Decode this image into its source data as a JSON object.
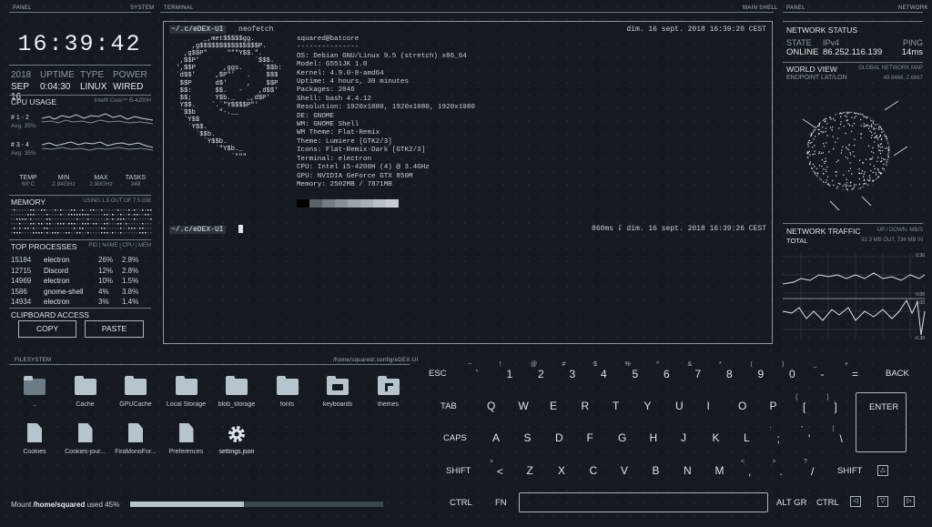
{
  "labels": {
    "panel_left": "PANEL",
    "system": "SYSTEM",
    "terminal": "TERMINAL",
    "main_shell": "MAIN SHELL",
    "panel_right": "PANEL",
    "network": "NETWORK",
    "filesystem": "FILESYSTEM",
    "fs_path": "/home/squared/.config/eDEX-UI"
  },
  "clock": "16:39:42",
  "sysinfo": {
    "headers": [
      "2018",
      "UPTIME",
      "TYPE",
      "POWER"
    ],
    "values": [
      "SEP 16",
      "0:04:30",
      "LINUX",
      "WIRED"
    ]
  },
  "cpu": {
    "title": "CPU USAGE",
    "model": "Intel® Core™ i5-4200H",
    "rows": [
      {
        "label": "# 1 - 2",
        "avg": "Avg. 35%"
      },
      {
        "label": "# 3 - 4",
        "avg": "Avg. 35%"
      }
    ],
    "stats_headers": [
      "TEMP",
      "MIN",
      "MAX",
      "TASKS"
    ],
    "stats_values": [
      "68°C",
      "2.94GHz",
      "2.99GHz",
      "248"
    ]
  },
  "memory": {
    "title": "MEMORY",
    "usage": "USING 1.5 OUT OF 7.5 GiB"
  },
  "processes": {
    "title": "TOP PROCESSES",
    "columns": "PID | NAME | CPU | MEM",
    "rows": [
      {
        "pid": "15184",
        "name": "electron",
        "cpu": "26%",
        "mem": "2.8%"
      },
      {
        "pid": "12715",
        "name": "Discord",
        "cpu": "12%",
        "mem": "2.8%"
      },
      {
        "pid": "14969",
        "name": "electron",
        "cpu": "10%",
        "mem": "1.5%"
      },
      {
        "pid": "1586",
        "name": "gnome-shell",
        "cpu": "4%",
        "mem": "3.8%"
      },
      {
        "pid": "14934",
        "name": "electron",
        "cpu": "3%",
        "mem": "1.4%"
      }
    ]
  },
  "clipboard": {
    "title": "CLIPBOARD ACCESS",
    "copy": "COPY",
    "paste": "PASTE"
  },
  "terminal": {
    "prompt": "~/.c/eDEX-UI",
    "command": "neofetch",
    "timestamp1": "dim. 16 sept. 2018 16:39:20 CEST",
    "timestamp2": "860ms ⮦ dim. 16 sept. 2018 16:39:26 CEST",
    "ascii": "        _,met$$$$$gg.\n     ,g$$$$$$$$$$$$$$$P.\n   ,g$$P\"     \"\"\"Y$$.\".\n  ,$$P'              `$$$.\n ',$$P       ,ggs.     `$$b:\n `d$$'     ,$P\"'   .    $$$\n  $$P      d$'     ,    $$P\n  $$:      $$.   -    ,d$$'\n  $$;      Y$b._   _,d$P'\n  Y$$.    `.`\"Y$$$$P\"'\n  `$$b      \"-.__\n   `Y$$\n    `Y$$.\n      `$$b.\n        `Y$$b.\n           `\"Y$b._\n               `\"\"\"",
    "info": "squared@batcore\n---------------\nOS: Debian GNU/Linux 9.5 (stretch) x86_64\nModel: G551JK 1.0\nKernel: 4.9.0-8-amd64\nUptime: 4 hours, 30 minutes\nPackages: 2046\nShell: bash 4.4.12\nResolution: 1920x1080, 1920x1080, 1920x1080\nDE: GNOME\nWM: GNOME Shell\nWM Theme: Flat-Remix\nTheme: Lumiere [GTK2/3]\nIcons: Flat-Remix-Dark [GTK2/3]\nTerminal: electron\nCPU: Intel i5-4200H (4) @ 3.4GHz\nGPU: NVIDIA GeForce GTX 850M\nMemory: 2502MB / 7871MB",
    "swatch_colors": [
      "#000000",
      "#5a6166",
      "#737a80",
      "#888f95",
      "#9ba2a8",
      "#aab1b6",
      "#b9c0c5",
      "#c7cdd1"
    ]
  },
  "network": {
    "status_title": "NETWORK STATUS",
    "headers": [
      "STATE",
      "IPv4",
      "PING"
    ],
    "values": [
      "ONLINE",
      "86.252.116.139",
      "14ms"
    ],
    "world_title": "WORLD VIEW",
    "world_sub": "GLOBAL NETWORK MAP",
    "endpoint": "ENDPOINT LAT/LON",
    "endpoint_val": "48.8466, 2.6667",
    "traffic_title": "NETWORK TRAFFIC",
    "traffic_sub": "UP / DOWN, MB/S",
    "total": "TOTAL",
    "total_val": "92.3 MB OUT, 736 MB IN",
    "axis": [
      "0.30",
      "0.00",
      "0.00",
      "-0.30"
    ]
  },
  "filesystem": {
    "items": [
      {
        "name": "..",
        "icon": "folder-up-icon"
      },
      {
        "name": "Cache",
        "icon": "folder-icon"
      },
      {
        "name": "GPUCache",
        "icon": "folder-icon"
      },
      {
        "name": "Local Storage",
        "icon": "folder-icon"
      },
      {
        "name": "blob_storage",
        "icon": "folder-icon"
      },
      {
        "name": "fonts",
        "icon": "folder-icon"
      },
      {
        "name": "keyboards",
        "icon": "keyboard-icon"
      },
      {
        "name": "themes",
        "icon": "themes-icon"
      },
      {
        "name": "Cookies",
        "icon": "file-icon"
      },
      {
        "name": "Cookies-jour...",
        "icon": "file-icon"
      },
      {
        "name": "FiraMonoFor...",
        "icon": "file-icon"
      },
      {
        "name": "Preferences",
        "icon": "file-icon"
      },
      {
        "name": "settings.json",
        "icon": "gear-icon"
      }
    ],
    "mount_prefix": "Mount",
    "mount_path": "/home/squared",
    "mount_used": "used 45%",
    "mount_fraction": 0.45
  },
  "keyboard": {
    "esc": "ESC",
    "back": "BACK",
    "tab": "TAB",
    "enter": "ENTER",
    "caps": "CAPS",
    "shift": "SHIFT",
    "ctrl": "CTRL",
    "fn": "FN",
    "altgr": "ALT GR",
    "row1": [
      [
        "~",
        "`"
      ],
      [
        "!",
        "1"
      ],
      [
        "@",
        "2"
      ],
      [
        "#",
        "3"
      ],
      [
        "$",
        "4"
      ],
      [
        "%",
        "5"
      ],
      [
        "^",
        "6"
      ],
      [
        "&",
        "7"
      ],
      [
        "*",
        "8"
      ],
      [
        "(",
        "9"
      ],
      [
        ")",
        "0"
      ],
      [
        "_",
        "-"
      ],
      [
        "+",
        "="
      ]
    ],
    "row2": [
      "Q",
      "W",
      "E",
      "R",
      "T",
      "Y",
      "U",
      "I",
      "O",
      "P",
      [
        "{",
        "["
      ],
      [
        "}",
        "]"
      ]
    ],
    "row3": [
      "A",
      "S",
      "D",
      "F",
      "G",
      "H",
      "J",
      "K",
      "L",
      [
        ":",
        ";"
      ],
      [
        "\"",
        "'"
      ],
      [
        "|",
        "\\"
      ]
    ],
    "row4": [
      [
        ">",
        "<"
      ],
      "Z",
      "X",
      "C",
      "V",
      "B",
      "N",
      "M",
      [
        "<",
        ","
      ],
      [
        ">",
        "."
      ],
      [
        "?",
        "/"
      ]
    ]
  }
}
